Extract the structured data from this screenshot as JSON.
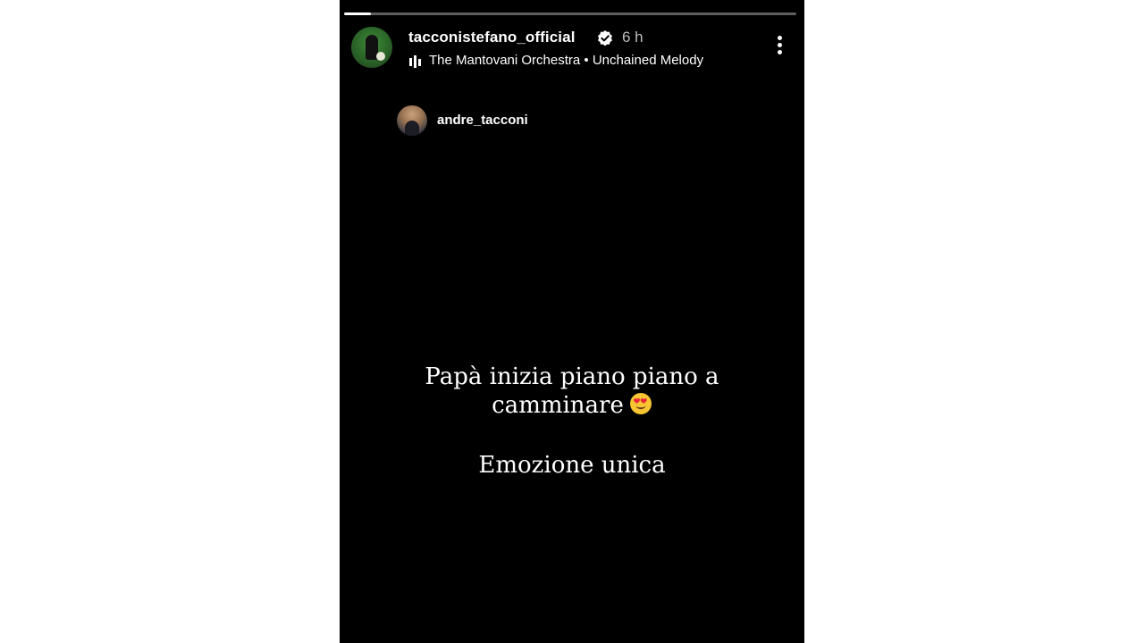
{
  "story": {
    "progress": 0.06,
    "author": {
      "username": "tacconistefano_official",
      "verified": true,
      "time": "6 h"
    },
    "music": "The Mantovani Orchestra • Unchained Melody",
    "mention": {
      "username": "andre_tacconi"
    },
    "caption": {
      "line1": "Papà inizia piano piano a",
      "line2": "camminare",
      "line2_emoji": "smiling-face-with-heart-eyes",
      "line3": "Emozione unica"
    }
  },
  "colors": {
    "background": "#000000",
    "page": "#ffffff",
    "text": "#ffffff",
    "muted": "#bdbdbd",
    "progress_track": "#5f5f5f",
    "progress_fill": "#ffffff"
  }
}
